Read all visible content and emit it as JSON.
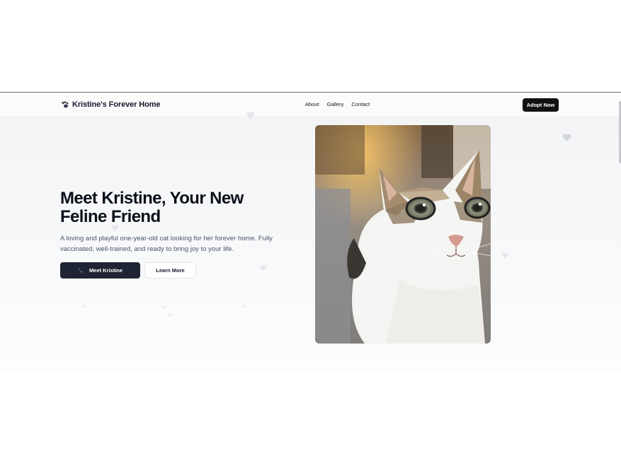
{
  "brand": {
    "name": "Kristine's Forever Home",
    "icon": "paw-icon"
  },
  "nav": {
    "links": [
      "About",
      "Gallery",
      "Contact"
    ],
    "cta": "Adopt Now"
  },
  "hero": {
    "title": "Meet Kristine, Your New Feline Friend",
    "description": "A loving and playful one-year-old cat looking for her forever home. Fully vaccinated, well-trained, and ready to bring joy to your life.",
    "primary_button": "Meet Kristine",
    "secondary_button": "Learn More"
  },
  "colors": {
    "dark": "#111111",
    "button_primary": "#1e2433",
    "text_muted": "#475569"
  }
}
